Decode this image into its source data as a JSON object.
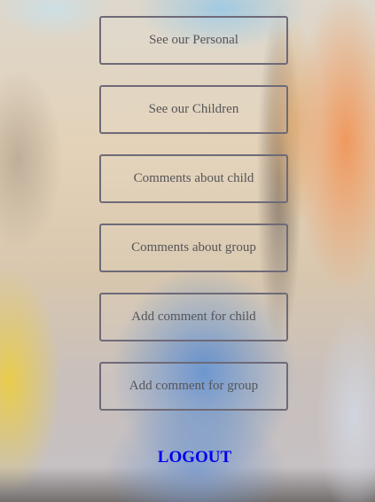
{
  "menu": {
    "items": [
      {
        "label": "See our Personal"
      },
      {
        "label": "See our Children"
      },
      {
        "label": "Comments about child"
      },
      {
        "label": "Comments about group"
      },
      {
        "label": "Add comment for child"
      },
      {
        "label": "Add comment for group"
      }
    ],
    "logout_label": "LOGOUT"
  },
  "colors": {
    "button_border": "#6e6a78",
    "button_text": "#555558",
    "logout_link": "#0000ee"
  }
}
